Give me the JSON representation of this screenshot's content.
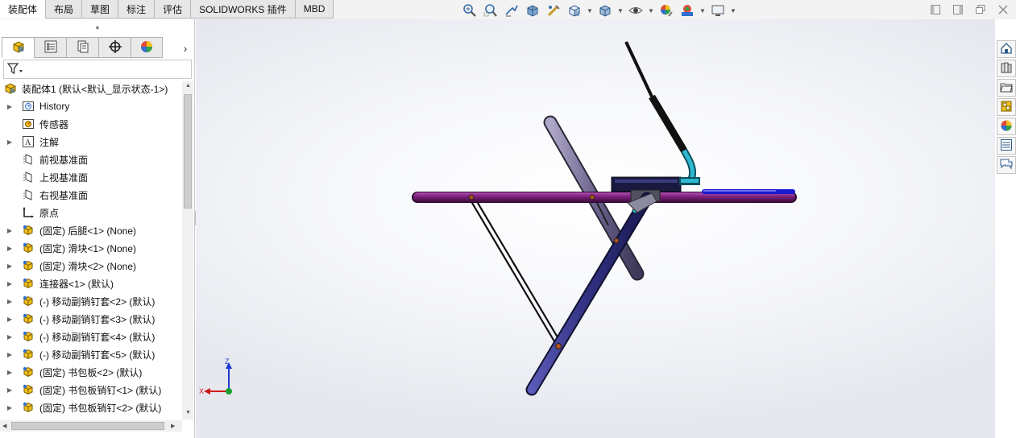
{
  "tabs": [
    "装配体",
    "布局",
    "草图",
    "标注",
    "评估",
    "SOLIDWORKS 插件",
    "MBD"
  ],
  "active_tab": "装配体",
  "toolbar_icons": [
    "zoom-to-fit-icon",
    "zoom-to-area-icon",
    "previous-view-icon",
    "section-view-icon",
    "dynamic-annotation-icon",
    "view-orientation-icon",
    "display-style-icon",
    "hide-show-items-icon",
    "edit-appearance-icon",
    "apply-scene-icon",
    "view-settings-icon"
  ],
  "panel_tabs": [
    "feature-manager-icon",
    "property-manager-icon",
    "configuration-manager-icon",
    "dimxpert-manager-icon",
    "display-manager-icon"
  ],
  "tree": [
    {
      "label": "装配体1  (默认<默认_显示状态-1>)",
      "icon": "assembly-icon",
      "expand": "down",
      "indent": 0
    },
    {
      "label": "History",
      "icon": "history-icon",
      "expand": "right",
      "indent": 1
    },
    {
      "label": "传感器",
      "icon": "sensor-icon",
      "expand": "",
      "indent": 1
    },
    {
      "label": "注解",
      "icon": "annotation-icon",
      "expand": "right",
      "indent": 1
    },
    {
      "label": "前视基准面",
      "icon": "plane-icon",
      "expand": "",
      "indent": 1
    },
    {
      "label": "上视基准面",
      "icon": "plane-icon",
      "expand": "",
      "indent": 1
    },
    {
      "label": "右视基准面",
      "icon": "plane-icon",
      "expand": "",
      "indent": 1
    },
    {
      "label": "原点",
      "icon": "origin-icon",
      "expand": "",
      "indent": 1
    },
    {
      "label": "(固定) 后腿<1> (None)",
      "icon": "part-icon",
      "expand": "right",
      "indent": 1
    },
    {
      "label": "(固定) 滑块<1> (None)",
      "icon": "part-icon",
      "expand": "right",
      "indent": 1
    },
    {
      "label": "(固定) 滑块<2> (None)",
      "icon": "part-icon",
      "expand": "right",
      "indent": 1
    },
    {
      "label": "连接器<1> (默认)",
      "icon": "part-icon",
      "expand": "right",
      "indent": 1
    },
    {
      "label": "(-) 移动副销钉套<2> (默认)",
      "icon": "part-icon",
      "expand": "right",
      "indent": 1
    },
    {
      "label": "(-) 移动副销钉套<3> (默认)",
      "icon": "part-icon",
      "expand": "right",
      "indent": 1
    },
    {
      "label": "(-) 移动副销钉套<4> (默认)",
      "icon": "part-icon",
      "expand": "right",
      "indent": 1
    },
    {
      "label": "(-) 移动副销钉套<5> (默认)",
      "icon": "part-icon",
      "expand": "right",
      "indent": 1
    },
    {
      "label": "(固定) 书包板<2> (默认)",
      "icon": "part-icon",
      "expand": "right",
      "indent": 1
    },
    {
      "label": "(固定) 书包板销钉<1> (默认)",
      "icon": "part-icon",
      "expand": "right",
      "indent": 1
    },
    {
      "label": "(固定) 书包板销钉<2> (默认)",
      "icon": "part-icon",
      "expand": "right",
      "indent": 1
    }
  ],
  "triad": {
    "z": "Z",
    "x": "X"
  },
  "task_pane_icons": [
    "solidworks-resources-icon",
    "design-library-icon",
    "file-explorer-icon",
    "view-palette-icon",
    "appearances-icon",
    "custom-properties-icon",
    "solidworks-forum-icon"
  ],
  "colors": {
    "beam_purple": "#7a1f7a",
    "leg_blue": "#303080",
    "accent_cyan": "#30b8d0"
  }
}
